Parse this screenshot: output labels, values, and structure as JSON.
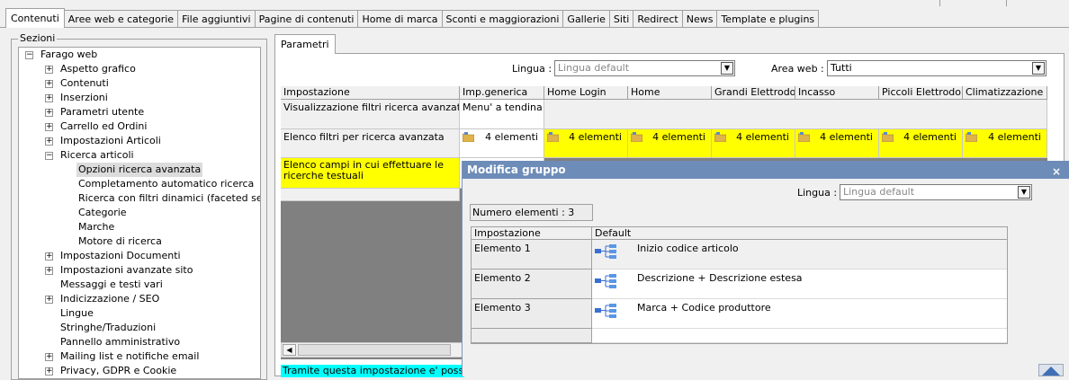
{
  "tabs": [
    "Contenuti",
    "Aree web e categorie",
    "File aggiuntivi",
    "Pagine di contenuti",
    "Home di marca",
    "Sconti e maggiorazioni",
    "Gallerie",
    "Siti",
    "Redirect",
    "News",
    "Template e plugins"
  ],
  "sidebar": {
    "title": "Sezioni",
    "root": "Farago web",
    "items": [
      {
        "label": "Aspetto grafico",
        "level": 1,
        "box": "+"
      },
      {
        "label": "Contenuti",
        "level": 1,
        "box": "+"
      },
      {
        "label": "Inserzioni",
        "level": 1,
        "box": "+"
      },
      {
        "label": "Parametri utente",
        "level": 1,
        "box": "+"
      },
      {
        "label": "Carrello ed Ordini",
        "level": 1,
        "box": "+"
      },
      {
        "label": "Impostazioni Articoli",
        "level": 1,
        "box": "+"
      },
      {
        "label": "Ricerca articoli",
        "level": 1,
        "box": "−"
      },
      {
        "label": "Opzioni ricerca avanzata",
        "level": 2,
        "box": "",
        "selected": true
      },
      {
        "label": "Completamento automatico ricerca",
        "level": 2,
        "box": ""
      },
      {
        "label": "Ricerca con filtri dinamici (faceted search)",
        "level": 2,
        "box": ""
      },
      {
        "label": "Categorie",
        "level": 2,
        "box": ""
      },
      {
        "label": "Marche",
        "level": 2,
        "box": ""
      },
      {
        "label": "Motore di ricerca",
        "level": 2,
        "box": ""
      },
      {
        "label": "Impostazioni Documenti",
        "level": 1,
        "box": "+"
      },
      {
        "label": "Impostazioni avanzate sito",
        "level": 1,
        "box": "+"
      },
      {
        "label": "Messaggi e testi vari",
        "level": 1,
        "box": ""
      },
      {
        "label": "Indicizzazione / SEO",
        "level": 1,
        "box": "+"
      },
      {
        "label": "Lingue",
        "level": 1,
        "box": ""
      },
      {
        "label": "Stringhe/Traduzioni",
        "level": 1,
        "box": ""
      },
      {
        "label": "Pannello amministrativo",
        "level": 1,
        "box": ""
      },
      {
        "label": "Mailing list e notifiche email",
        "level": 1,
        "box": "+"
      },
      {
        "label": "Privacy, GDPR e Cookie",
        "level": 1,
        "box": "+"
      }
    ]
  },
  "params": {
    "tab_label": "Parametri",
    "lingua_label": "Lingua :",
    "lingua_value": "Lingua default",
    "area_label": "Area web :",
    "area_value": "Tutti",
    "columns": [
      "Impostazione",
      "Imp.generica",
      "Home Login",
      "Home",
      "Grandi Elettrodo...",
      "Incasso",
      "Piccoli Elettrodo...",
      "Climatizzazione"
    ],
    "rows": [
      {
        "label": "Visualizzazione filtri ricerca avanzata",
        "generic": "Menu' a tendina"
      },
      {
        "label": "Elenco filtri per ricerca avanzata",
        "count": "4 elementi"
      },
      {
        "label": "Elenco campi in cui effettuare le ricerche testuali"
      }
    ],
    "description": "Tramite questa impostazione e' possibile s"
  },
  "dialog": {
    "title": "Modifica gruppo",
    "close": "×",
    "lingua_label": "Lingua :",
    "lingua_value": "Lingua default",
    "numero": "Numero elementi : 3",
    "columns": [
      "Impostazione",
      "Default"
    ],
    "items": [
      {
        "label": "Elemento 1",
        "value": "Inizio codice articolo"
      },
      {
        "label": "Elemento 2",
        "value": "Descrizione + Descrizione estesa"
      },
      {
        "label": "Elemento 3",
        "value": "Marca + Codice produttore"
      }
    ]
  },
  "colors": {
    "yellow": "#ffff00",
    "cyan": "#00ffff",
    "dialog_title": "#6d8cb8"
  }
}
